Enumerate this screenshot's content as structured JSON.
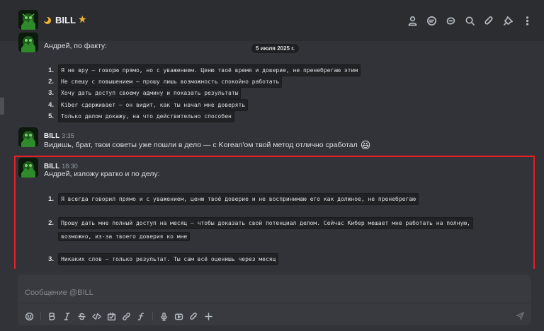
{
  "header": {
    "channel_name": "BILL",
    "star": "★"
  },
  "date_divider": "5 июля 2025 г.",
  "message_1": {
    "text": "Андрей, по факту:",
    "items": [
      {
        "num": "1.",
        "text": "Я не вру — говорю прямо, но с уважением. Ценю твоё время и доверие, не пренебрегаю этим"
      },
      {
        "num": "2.",
        "text": "Не спешу с повышением — прошу лишь возможность спокойно работать"
      },
      {
        "num": "3.",
        "text": "Хочу дать доступ своему админу и показать результаты"
      },
      {
        "num": "4.",
        "text": "Kiber сдерживает — он видит, как ты начал мне доверять"
      },
      {
        "num": "5.",
        "text": "Только делом докажу, на что действительно способен"
      }
    ]
  },
  "message_2": {
    "author": "BILL",
    "time": "3:35",
    "text": "Видишь, брат, твои советы уже пошли в дело — с Korean'ом твой метод отлично сработал",
    "emoji": "😆"
  },
  "message_3": {
    "author": "BILL",
    "time": "18:30",
    "text": "Андрей, изложу кратко и по делу:",
    "items": [
      {
        "num": "1.",
        "text": "Я всегда говорил прямо и с уважением, ценю твоё доверие и не воспринимаю его как должное, не пренебрегаю"
      },
      {
        "num": "2.",
        "text_line1": "Прошу дать мне полный доступ на месяц — чтобы доказать свой потенциал делом. Сейчас Кибер мешает мне работать на полную,",
        "text_line2": "возможно, из-за твоего доверия ко мне"
      },
      {
        "num": "3.",
        "text": "Никаких слов — только результат. Ты сам всё оценишь через месяц"
      }
    ]
  },
  "composer": {
    "placeholder": "Сообщение @BILL"
  },
  "colors": {
    "highlight_border": "#e81f24",
    "star": "#f0b232"
  }
}
